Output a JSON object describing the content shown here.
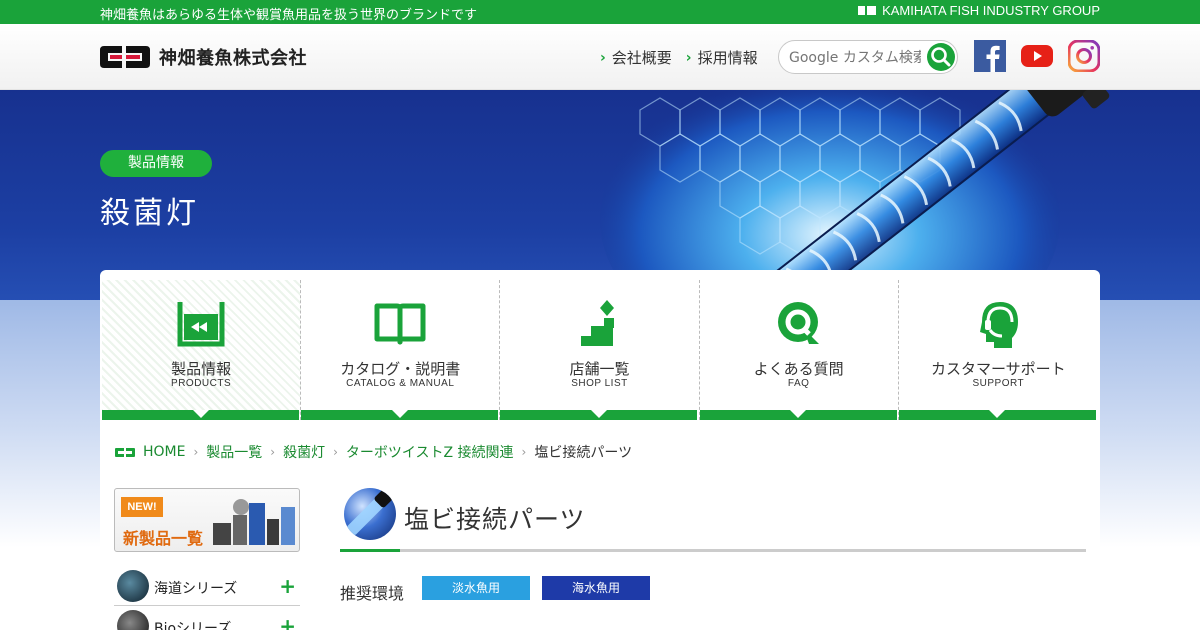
{
  "topbar": {
    "tagline": "神畑養魚はあらゆる生体や観賞魚用品を扱う世界のブランドです",
    "group": "KAMIHATA FISH INDUSTRY GROUP"
  },
  "header": {
    "company_name": "神畑養魚株式会社",
    "nav": [
      {
        "label": "会社概要"
      },
      {
        "label": "採用情報"
      }
    ],
    "search_placeholder": "Google カスタム検索",
    "social": [
      "facebook-icon",
      "youtube-icon",
      "instagram-icon"
    ]
  },
  "hero": {
    "badge": "製品情報",
    "title": "殺菌灯"
  },
  "menu": [
    {
      "label": "製品情報",
      "sub": "PRODUCTS",
      "icon": "aquarium-icon",
      "active": true
    },
    {
      "label": "カタログ・説明書",
      "sub": "CATALOG & MANUAL",
      "icon": "book-icon"
    },
    {
      "label": "店舗一覧",
      "sub": "SHOP LIST",
      "icon": "shop-map-icon"
    },
    {
      "label": "よくある質問",
      "sub": "FAQ",
      "icon": "faq-icon"
    },
    {
      "label": "カスタマーサポート",
      "sub": "SUPPORT",
      "icon": "headset-icon"
    }
  ],
  "breadcrumb": {
    "items": [
      "HOME",
      "製品一覧",
      "殺菌灯",
      "ターボツイストZ 接続関連"
    ],
    "current": "塩ビ接続パーツ"
  },
  "sidebar": {
    "new_badge": "NEW!",
    "new_label": "新製品一覧",
    "items": [
      {
        "label": "海道シリーズ"
      },
      {
        "label": "Bioシリーズ"
      }
    ]
  },
  "content": {
    "title": "塩ビ接続パーツ",
    "env_label": "推奨環境",
    "env_tags": [
      "淡水魚用",
      "海水魚用"
    ]
  },
  "colors": {
    "brand_green": "#1aa33a",
    "hero_blue": "#17318f",
    "freshwater": "#2aa0e0",
    "saltwater": "#1e3aa8"
  }
}
